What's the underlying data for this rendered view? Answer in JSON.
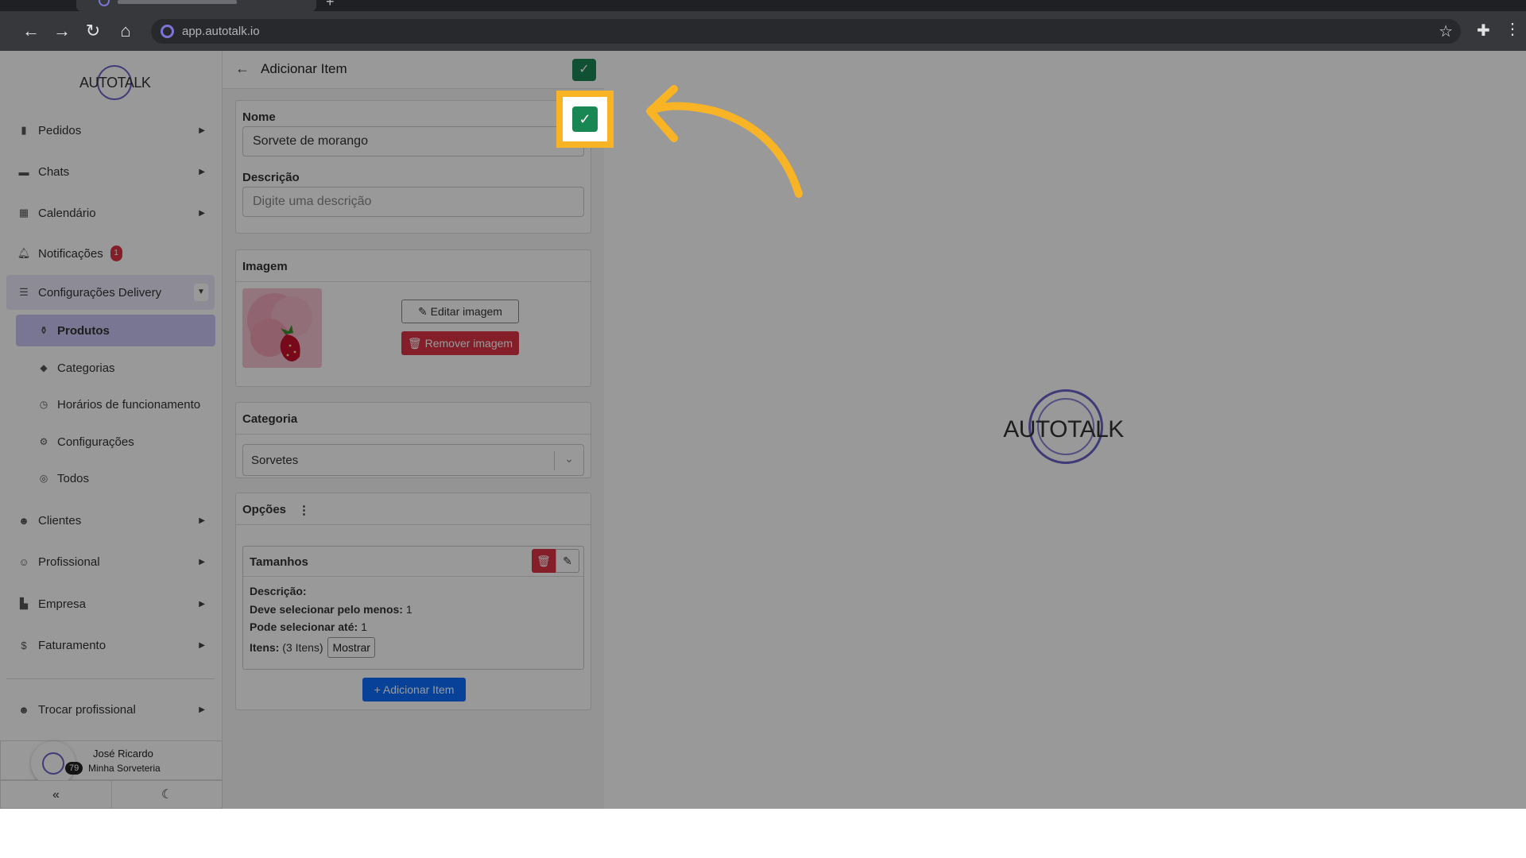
{
  "browser": {
    "url": "app.autotalk.io"
  },
  "sidebar": {
    "logo_text": "AUTOTALK",
    "items": [
      {
        "label": "Pedidos",
        "icon": "clipboard-icon"
      },
      {
        "label": "Chats",
        "icon": "comment-icon"
      },
      {
        "label": "Calendário",
        "icon": "calendar-icon"
      },
      {
        "label": "Notificações",
        "icon": "bell-icon",
        "badge": "1"
      },
      {
        "label": "Configurações Delivery",
        "icon": "sliders-icon"
      }
    ],
    "subitems": [
      {
        "label": "Produtos",
        "icon": "bottle-icon"
      },
      {
        "label": "Categorias",
        "icon": "tag-icon"
      },
      {
        "label": "Horários de funcionamento",
        "icon": "clock-icon"
      },
      {
        "label": "Configurações",
        "icon": "gear-icon"
      },
      {
        "label": "Todos",
        "icon": "globe-icon"
      }
    ],
    "items_after": [
      {
        "label": "Clientes",
        "icon": "users-icon"
      },
      {
        "label": "Profissional",
        "icon": "user-tie-icon"
      },
      {
        "label": "Empresa",
        "icon": "building-icon"
      },
      {
        "label": "Faturamento",
        "icon": "dollar-icon"
      }
    ],
    "switch_label": "Trocar profissional",
    "user": {
      "name": "José Ricardo",
      "company": "Minha Sorveteria",
      "count": "79"
    }
  },
  "form": {
    "title": "Adicionar Item",
    "name_label": "Nome",
    "name_value": "Sorvete de morango",
    "desc_label": "Descrição",
    "desc_placeholder": "Digite uma descrição",
    "image_header": "Imagem",
    "edit_image": "Editar imagem",
    "remove_image": "Remover imagem",
    "category_header": "Categoria",
    "category_value": "Sorvetes",
    "options_header": "Opções",
    "option": {
      "title": "Tamanhos",
      "desc_label": "Descrição:",
      "min_label": "Deve selecionar pelo menos:",
      "min_value": "1",
      "max_label": "Pode selecionar até:",
      "max_value": "1",
      "items_label": "Itens:",
      "items_value": "(3 Itens)",
      "show_button": "Mostrar"
    },
    "add_item_button": "Adicionar Item"
  },
  "preview": {
    "logo_text": "AUTOTALK"
  },
  "colors": {
    "accent": "#6a63c6",
    "highlight": "#f8b425",
    "confirm": "#198754",
    "danger": "#dc3545",
    "primary": "#0d6efd"
  }
}
